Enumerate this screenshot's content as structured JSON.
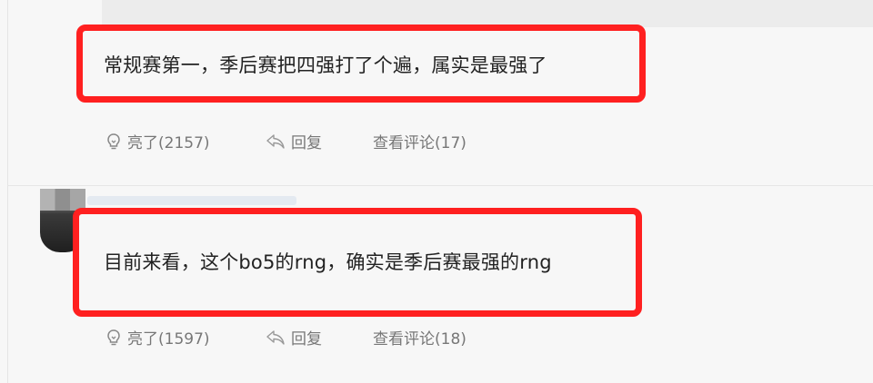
{
  "comments": [
    {
      "text": "常规赛第一，季后赛把四强打了个遍，属实是最强了",
      "like_label": "亮了(2157)",
      "reply_label": "回复",
      "view_comments_label": "查看评论(17)"
    },
    {
      "text": "目前来看，这个bo5的rng，确实是季后赛最强的rng",
      "like_label": "亮了(1597)",
      "reply_label": "回复",
      "view_comments_label": "查看评论(18)"
    }
  ],
  "colors": {
    "highlight_border": "#ff2020",
    "action_text": "#777777",
    "background": "#f7f7f7"
  },
  "icons": [
    "lightbulb-icon",
    "reply-arrow-icon"
  ]
}
